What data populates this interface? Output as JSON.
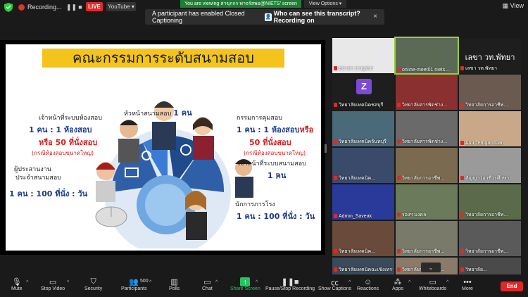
{
  "topbar": {
    "recording_label": "Recording...",
    "live_label": "LIVE",
    "youtube_label": "YouTube",
    "share_banner": "You are viewing สาขุกกร พาจร์สพอ@NIETS' screen",
    "view_options": "View Options",
    "view_label": "View"
  },
  "notification": {
    "text": "A participant has enabled Closed Captioning",
    "question": "Who can see this transcript? Recording on",
    "close": "×"
  },
  "slide": {
    "title": "คณะกรรมการระดับสนามสอบ",
    "head": "หัวหน้าสนามสอบ",
    "head_count": "1 คน",
    "room_staff": "เจ้าหน้าที่ระบบห้องสอบ",
    "room_ratio": "1 คน : 1 ห้องสอบ",
    "room_or": "หรือ 50 ที่นั่งสอบ",
    "room_note": "(กรณีห้องสอบขนาดใหญ่)",
    "proctor": "กรรมการคุมสอบ",
    "proctor_ratio": "1 คน : 1 ห้องสอบ",
    "proctor_or": "หรือ",
    "proctor_seats": "50 ที่นั่งสอบ",
    "proctor_note": "(กรณีห้องสอบขนาดใหญ่)",
    "coordinator_line1": "ผู้ประสานงาน",
    "coordinator_line2": "ประจำสนามสอบ",
    "coordinator_ratio": "1 คน : 100 ที่นั่ง : วัน",
    "site_staff": "เจ้าหน้าที่ระบบสนามสอบ",
    "site_count": "1 คน",
    "janitor": "นักการภารโรง",
    "janitor_ratio": "1 คน : 100 ที่นั่ง : วัน"
  },
  "gallery": {
    "tiles": [
      {
        "name": "ธนาดา กาญจนา",
        "bg": "#e8e8e8"
      },
      {
        "name": "online-meet01 niets...",
        "bg": "#5a6a55"
      },
      {
        "name": "เลขา วท.พัทยา",
        "bg": "#1e1e1e",
        "big": "เลขา วท.พัทยา"
      },
      {
        "name": "วิทยาลัยเทคนิคชลบุรี",
        "bg": "#1e1e1e",
        "letter": "Z"
      },
      {
        "name": "วิทยาลัยสารพัดช่าง...",
        "bg": "#8a3030"
      },
      {
        "name": "วิทยาลัยการอาชีพ...",
        "bg": "#6a5a50"
      },
      {
        "name": "วิทยาลัยเทคนิคจันทบุรี",
        "bg": "#4a6a7a"
      },
      {
        "name": "วิทยาลัยสารพัดช่าง...",
        "bg": "#6a6a6a"
      },
      {
        "name": "Anu Tetngamtuan",
        "bg": "#c8a888"
      },
      {
        "name": "วิทยาลัยเทคนิค...",
        "bg": "#3a4a6a"
      },
      {
        "name": "วิทยาลัยการอาชีพ...",
        "bg": "#7a6a50"
      },
      {
        "name": "สัญญา (อาชีวะศึกษา)",
        "bg": "#9a9a9a"
      },
      {
        "name": "Admin_Saveak",
        "bg": "#2a3a9a"
      },
      {
        "name": "รองฯ มงคล",
        "bg": "#6a7a5a"
      },
      {
        "name": "วิทยาลัยการอาชีพ...",
        "bg": "#5a6a4a"
      },
      {
        "name": "วิทยาลัยเทคนิค...",
        "bg": "#6a4a3a"
      },
      {
        "name": "วิทยาลัยการอาชีพ...",
        "bg": "#7a7a6a"
      },
      {
        "name": "วิทยาลัยการอาชีพ...",
        "bg": "#5a5a5a"
      },
      {
        "name": "วิทยาลัยเทคนิคฉะเชิงเทรา",
        "bg": "#3a4a5a"
      },
      {
        "name": "วิทยาลัยการอาชีพ...",
        "bg": "#8a7a6a"
      },
      {
        "name": "วิทยาลัย...",
        "bg": "#4a4a4a"
      }
    ]
  },
  "toolbar": {
    "mute": "Mute",
    "stop_video": "Stop Video",
    "security": "Security",
    "participants": "Participants",
    "participants_count": "500",
    "polls": "Polls",
    "chat": "Chat",
    "share_screen": "Share Screen",
    "pause_recording": "Pause/Stop Recording",
    "show_captions": "Show Captions",
    "reactions": "Reactions",
    "apps": "Apps",
    "whiteboards": "Whiteboards",
    "more": "More",
    "end": "End"
  },
  "colors": {
    "title_yellow": "#f4c41c",
    "thai_blue": "#1b3a8c",
    "thai_red": "#d42020",
    "live_red": "#e02828",
    "share_green": "#22c55e",
    "active_border": "#9acd32"
  }
}
